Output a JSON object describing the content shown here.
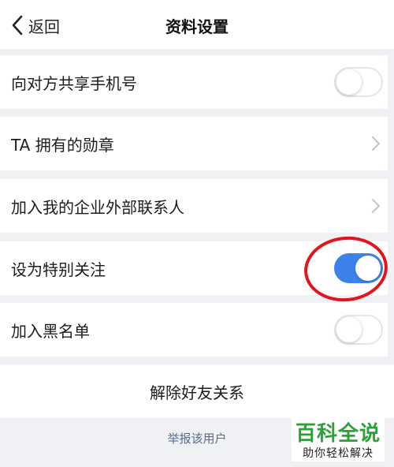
{
  "header": {
    "back_label": "返回",
    "title": "资料设置"
  },
  "settings": [
    {
      "label": "向对方共享手机号",
      "control": "toggle",
      "on": false
    },
    {
      "label": "TA 拥有的勋章",
      "control": "chevron"
    },
    {
      "label": "加入我的企业外部联系人",
      "control": "chevron"
    },
    {
      "label": "设为特别关注",
      "control": "toggle",
      "on": true
    },
    {
      "label": "加入黑名单",
      "control": "toggle",
      "on": false
    }
  ],
  "actions": {
    "remove_friend": "解除好友关系",
    "report_user": "举报该用户"
  },
  "watermark": {
    "title": "百科全说",
    "subtitle": "助你轻松解决"
  },
  "colors": {
    "toggle_on": "#3d82ea",
    "highlight_circle": "#e3141b",
    "watermark_green": "#2aa236",
    "report_link": "#5a6b85"
  }
}
